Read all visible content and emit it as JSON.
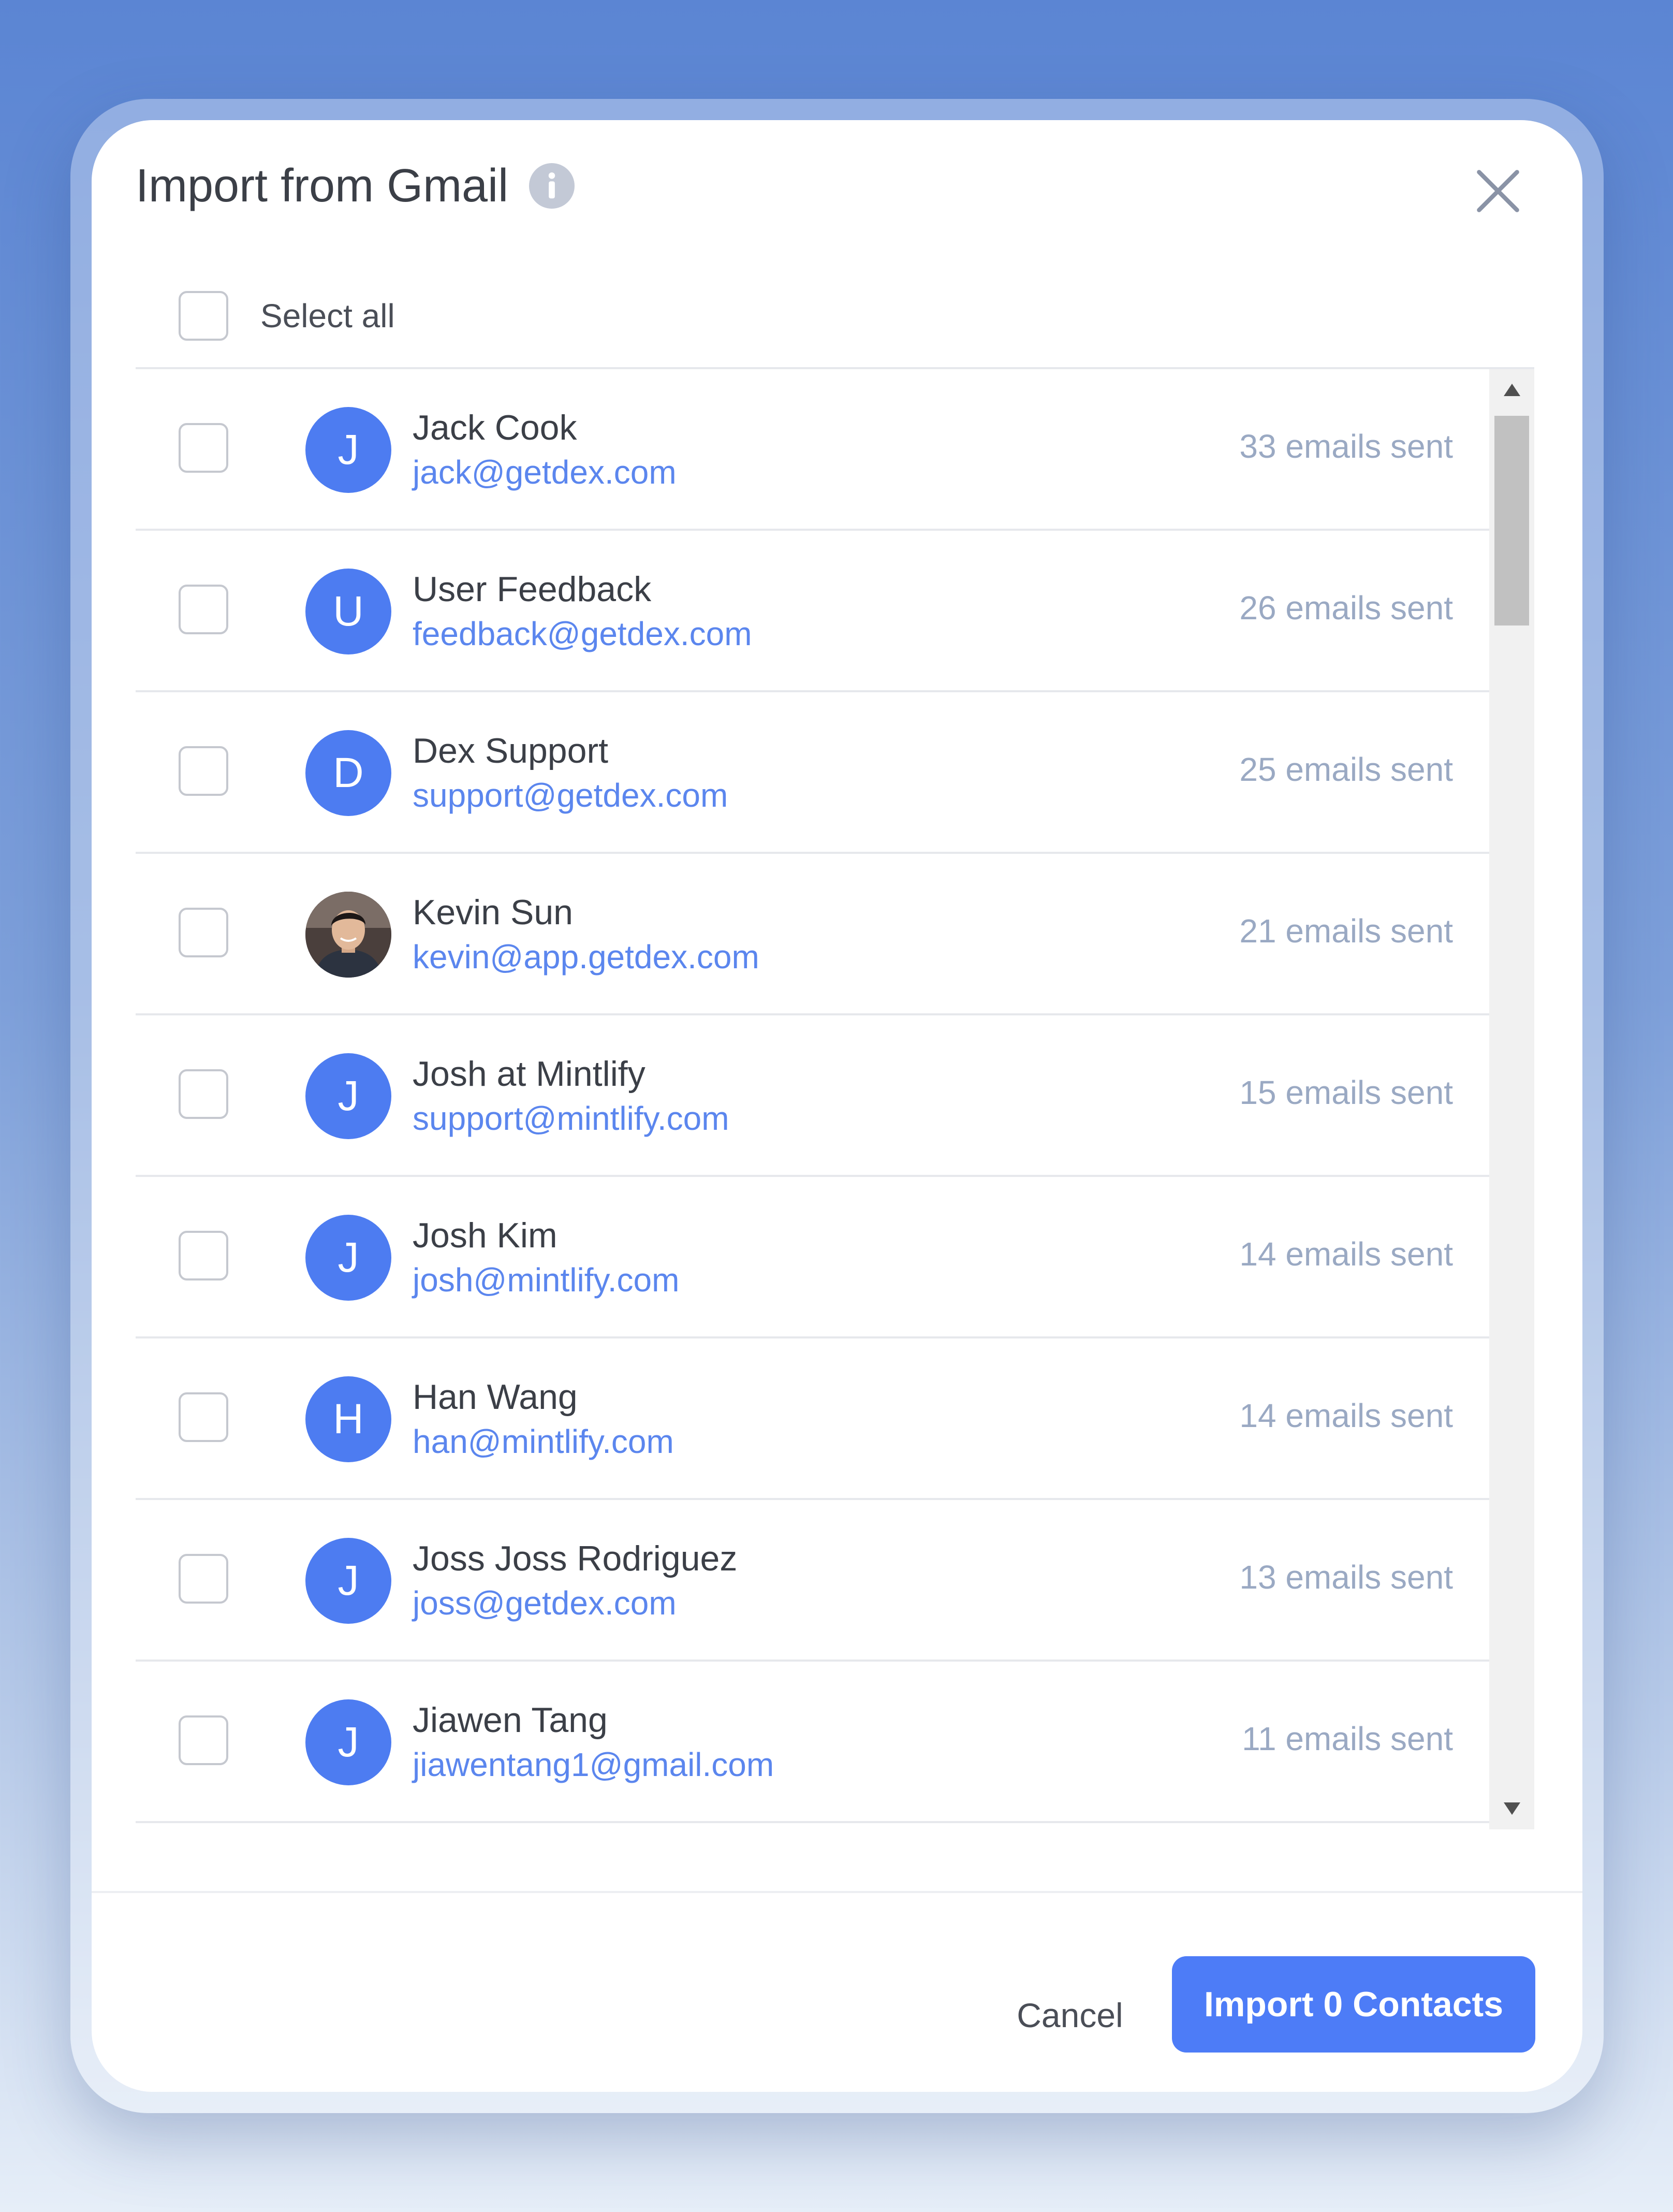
{
  "dialog": {
    "title": "Import from Gmail",
    "select_all_label": "Select all"
  },
  "icons": {
    "info": "info-icon",
    "close": "close-icon",
    "scroll_up": "triangle-up-icon",
    "scroll_down": "triangle-down-icon"
  },
  "colors": {
    "accent": "#4d7cf7",
    "avatar": "#4d7cf1",
    "email_link": "#5b86ee",
    "muted_count": "#9aa9c3"
  },
  "contacts": [
    {
      "initial": "J",
      "name": "Jack Cook",
      "email": "jack@getdex.com",
      "count": "33 emails sent"
    },
    {
      "initial": "U",
      "name": "User Feedback",
      "email": "feedback@getdex.com",
      "count": "26 emails sent"
    },
    {
      "initial": "D",
      "name": "Dex Support",
      "email": "support@getdex.com",
      "count": "25 emails sent"
    },
    {
      "initial": "",
      "name": "Kevin Sun",
      "email": "kevin@app.getdex.com",
      "count": "21 emails sent"
    },
    {
      "initial": "J",
      "name": "Josh at Mintlify",
      "email": "support@mintlify.com",
      "count": "15 emails sent"
    },
    {
      "initial": "J",
      "name": "Josh Kim",
      "email": "josh@mintlify.com",
      "count": "14 emails sent"
    },
    {
      "initial": "H",
      "name": "Han Wang",
      "email": "han@mintlify.com",
      "count": "14 emails sent"
    },
    {
      "initial": "J",
      "name": "Joss Joss Rodriguez",
      "email": "joss@getdex.com",
      "count": "13 emails sent"
    },
    {
      "initial": "J",
      "name": "Jiawen Tang",
      "email": "jiawentang1@gmail.com",
      "count": "11 emails sent"
    }
  ],
  "footer": {
    "cancel_label": "Cancel",
    "import_label": "Import 0 Contacts"
  }
}
